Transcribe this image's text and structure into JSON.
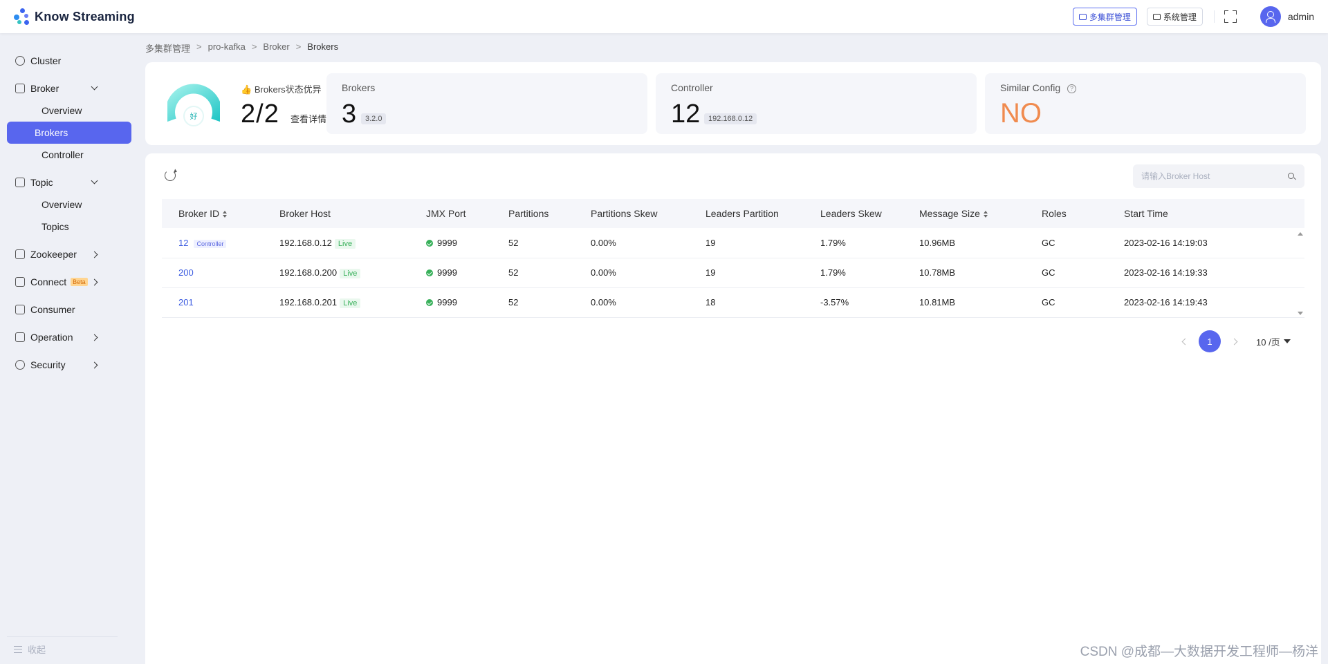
{
  "app": {
    "name": "Know Streaming"
  },
  "header": {
    "multi_cluster_btn": "多集群管理",
    "system_btn": "系统管理",
    "user": "admin"
  },
  "sidebar": {
    "cluster": "Cluster",
    "broker": "Broker",
    "broker_overview": "Overview",
    "broker_brokers": "Brokers",
    "broker_controller": "Controller",
    "topic": "Topic",
    "topic_overview": "Overview",
    "topic_topics": "Topics",
    "zookeeper": "Zookeeper",
    "connect": "Connect",
    "connect_badge": "Beta",
    "consumer": "Consumer",
    "operation": "Operation",
    "security": "Security",
    "collapse": "收起"
  },
  "breadcrumb": [
    "多集群管理",
    "pro-kafka",
    "Broker",
    "Brokers"
  ],
  "breadcrumb_sep": ">",
  "summary": {
    "health_emoji": "👍",
    "health_title": "Brokers状态优异",
    "health_value": "2/2",
    "health_link": "查看详情",
    "gauge_label": "好",
    "brokers_label": "Brokers",
    "brokers_count": "3",
    "brokers_version": "3.2.0",
    "controller_label": "Controller",
    "controller_id": "12",
    "controller_host": "192.168.0.12",
    "similar_label": "Similar Config",
    "similar_help": "?",
    "similar_value": "NO"
  },
  "search": {
    "placeholder": "请输入Broker Host"
  },
  "table": {
    "headers": [
      "Broker ID",
      "Broker Host",
      "JMX Port",
      "Partitions",
      "Partitions Skew",
      "Leaders Partition",
      "Leaders Skew",
      "Message Size",
      "Roles",
      "Start Time"
    ],
    "controller_tag": "Controller",
    "live_tag": "Live",
    "rows": [
      {
        "id": "12",
        "host": "192.168.0.12",
        "jmx": "9999",
        "partitions": "52",
        "pskew": "0.00%",
        "leaders": "19",
        "lskew": "1.79%",
        "size": "10.96MB",
        "roles": "GC",
        "start": "2023-02-16 14:19:03"
      },
      {
        "id": "200",
        "host": "192.168.0.200",
        "jmx": "9999",
        "partitions": "52",
        "pskew": "0.00%",
        "leaders": "19",
        "lskew": "1.79%",
        "size": "10.78MB",
        "roles": "GC",
        "start": "2023-02-16 14:19:33"
      },
      {
        "id": "201",
        "host": "192.168.0.201",
        "jmx": "9999",
        "partitions": "52",
        "pskew": "0.00%",
        "leaders": "18",
        "lskew": "-3.57%",
        "size": "10.81MB",
        "roles": "GC",
        "start": "2023-02-16 14:19:43"
      }
    ]
  },
  "pagination": {
    "current": "1",
    "page_size": "10 /页"
  },
  "watermark": "CSDN @成都—大数据开发工程师—杨洋",
  "colors": {
    "primary": "#5866ee",
    "success": "#38b05a",
    "warning": "#f08b4f"
  }
}
